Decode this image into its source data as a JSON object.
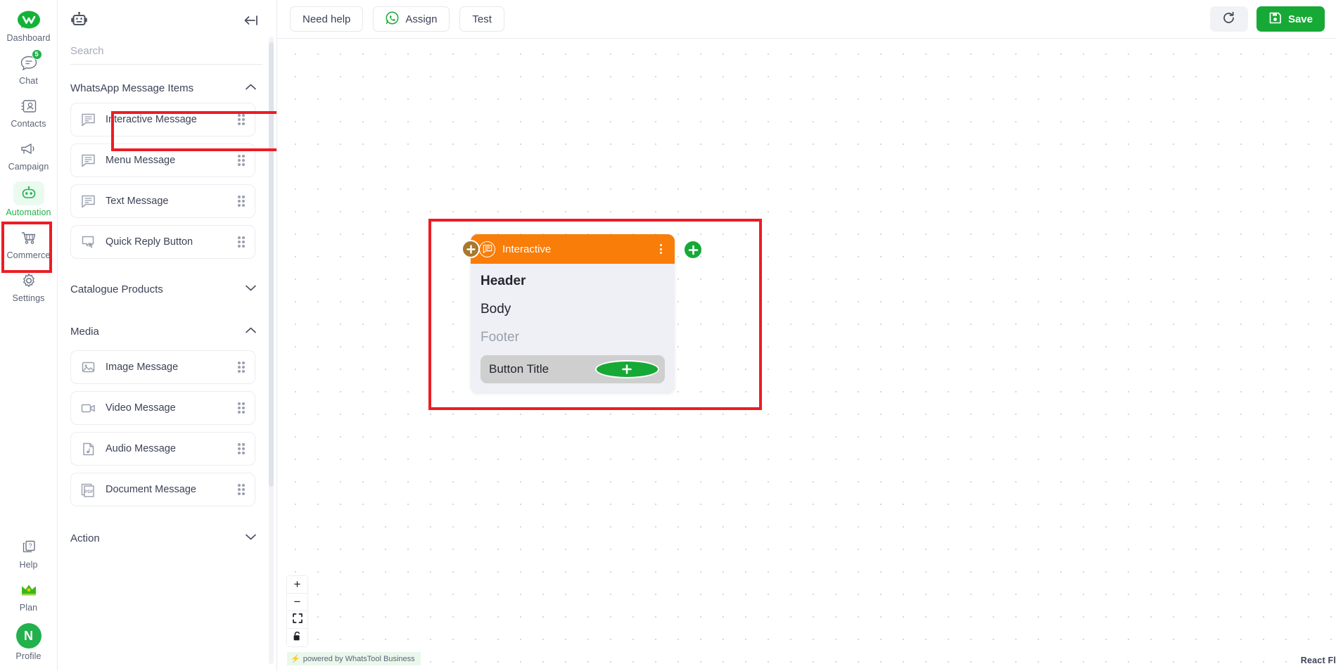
{
  "rail": {
    "items": [
      {
        "label": "Dashboard",
        "icon": "whatstool-logo-icon",
        "active": false,
        "badge": null
      },
      {
        "label": "Chat",
        "icon": "chat-bubble-icon",
        "active": false,
        "badge": "5"
      },
      {
        "label": "Contacts",
        "icon": "contacts-card-icon",
        "active": false,
        "badge": null
      },
      {
        "label": "Campaign",
        "icon": "megaphone-icon",
        "active": false,
        "badge": null
      },
      {
        "label": "Automation",
        "icon": "robot-icon",
        "active": true,
        "badge": null
      },
      {
        "label": "Commerce",
        "icon": "shopping-cart-icon",
        "active": false,
        "badge": null
      },
      {
        "label": "Settings",
        "icon": "gear-icon",
        "active": false,
        "badge": null
      }
    ],
    "bottom_items": [
      {
        "label": "Help",
        "icon": "help-question-icon"
      },
      {
        "label": "Plan",
        "icon": "crown-icon"
      },
      {
        "label": "Profile",
        "icon": "avatar-icon",
        "avatar_initial": "N"
      }
    ],
    "active_color": "#22b14c",
    "label_color": "#5a6377"
  },
  "panel": {
    "header_icon": "robot-icon",
    "collapse_icon": "collapse-left-arrow-icon",
    "search": {
      "value": "",
      "placeholder": "Search"
    },
    "groups": [
      {
        "title": "WhatsApp Message Items",
        "expanded": true,
        "chevron": "chevron-up-icon",
        "items": [
          {
            "label": "Interactive Message",
            "icon": "interactive-message-icon",
            "highlighted": true
          },
          {
            "label": "Menu Message",
            "icon": "menu-message-icon",
            "highlighted": false
          },
          {
            "label": "Text Message",
            "icon": "text-message-icon",
            "highlighted": false
          },
          {
            "label": "Quick Reply Button",
            "icon": "quick-reply-icon",
            "highlighted": false
          }
        ]
      },
      {
        "title": "Catalogue Products",
        "expanded": false,
        "chevron": "chevron-down-icon",
        "items": []
      },
      {
        "title": "Media",
        "expanded": true,
        "chevron": "chevron-up-icon",
        "items": [
          {
            "label": "Image Message",
            "icon": "image-icon",
            "highlighted": false
          },
          {
            "label": "Video Message",
            "icon": "video-camera-icon",
            "highlighted": false
          },
          {
            "label": "Audio Message",
            "icon": "audio-file-icon",
            "highlighted": false
          },
          {
            "label": "Document Message",
            "icon": "pdf-document-icon",
            "highlighted": false
          }
        ]
      },
      {
        "title": "Action",
        "expanded": false,
        "chevron": "chevron-down-icon",
        "items": []
      }
    ]
  },
  "topbar": {
    "need_help_label": "Need help",
    "assign_label": "Assign",
    "assign_icon": "whatsapp-icon",
    "test_label": "Test",
    "refresh_icon": "refresh-icon",
    "save_label": "Save",
    "save_icon": "save-disk-icon",
    "save_color": "#17a936"
  },
  "canvas": {
    "node": {
      "type_label": "Interactive",
      "type_icon": "interactive-message-icon",
      "header_color": "#f97d09",
      "kebab_icon": "kebab-menu-icon",
      "left_handle_icon": "plus-icon",
      "right_handle_icon": "plus-icon",
      "header_text": "Header",
      "body_text": "Body",
      "footer_text": "Footer",
      "button_title": "Button Title",
      "button_handle_icon": "plus-icon"
    },
    "controls": {
      "zoom_in": "+",
      "zoom_out": "−",
      "fit_view_icon": "fit-view-icon",
      "lock_icon": "lock-icon"
    },
    "watermark": "powered by WhatsTool Business",
    "watermark_icon": "bolt-icon",
    "attribution": "React Fl",
    "highlight_color": "#ed1c24"
  }
}
